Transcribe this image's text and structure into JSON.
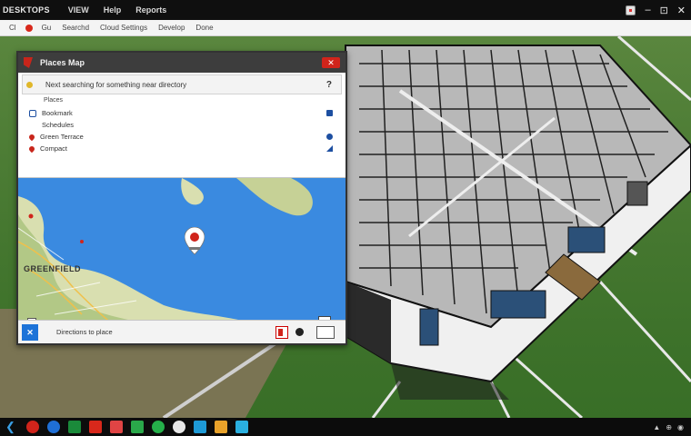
{
  "os_bar": {
    "brand": "DESKTOPS",
    "menu": [
      "VIEW",
      "Help",
      "Reports"
    ],
    "controls": {
      "minimize": "–",
      "maximize": "⊡",
      "close": "✕"
    }
  },
  "browser": {
    "items": [
      "Cl",
      "Gu",
      "Searchd",
      "Cloud Settings",
      "Develop",
      "Done"
    ]
  },
  "window": {
    "title": "Places Map",
    "close_label": "✕",
    "search": {
      "value": "Next searching for something near directory",
      "help": "?"
    },
    "results_header": "Places",
    "results": [
      {
        "label": "Bookmark",
        "icon": "bookmark-icon",
        "action": "stop-icon"
      },
      {
        "label": "Schedules",
        "icon": "blank-icon",
        "action": "none"
      },
      {
        "label": "Green Terrace",
        "icon": "pin-icon",
        "action": "info-icon"
      },
      {
        "label": "Compact",
        "icon": "pin-icon",
        "action": "navigate-icon"
      }
    ],
    "map": {
      "place_label": "GREENFIELD",
      "marker": "location-pin"
    },
    "footer": {
      "text": "Directions to place"
    }
  },
  "taskbar": {
    "icons": [
      "back-icon",
      "browser-icon",
      "globe-icon",
      "terminal-icon",
      "mail-icon",
      "photos-icon",
      "messages-icon",
      "maps-icon",
      "chat-icon",
      "notes-icon",
      "folder-icon",
      "store-icon"
    ],
    "tray": [
      "▲",
      "⊕",
      "◉"
    ]
  },
  "colors": {
    "accent": "#d0241b",
    "map_water": "#3a8ae0",
    "link_blue": "#1d4fa1"
  }
}
